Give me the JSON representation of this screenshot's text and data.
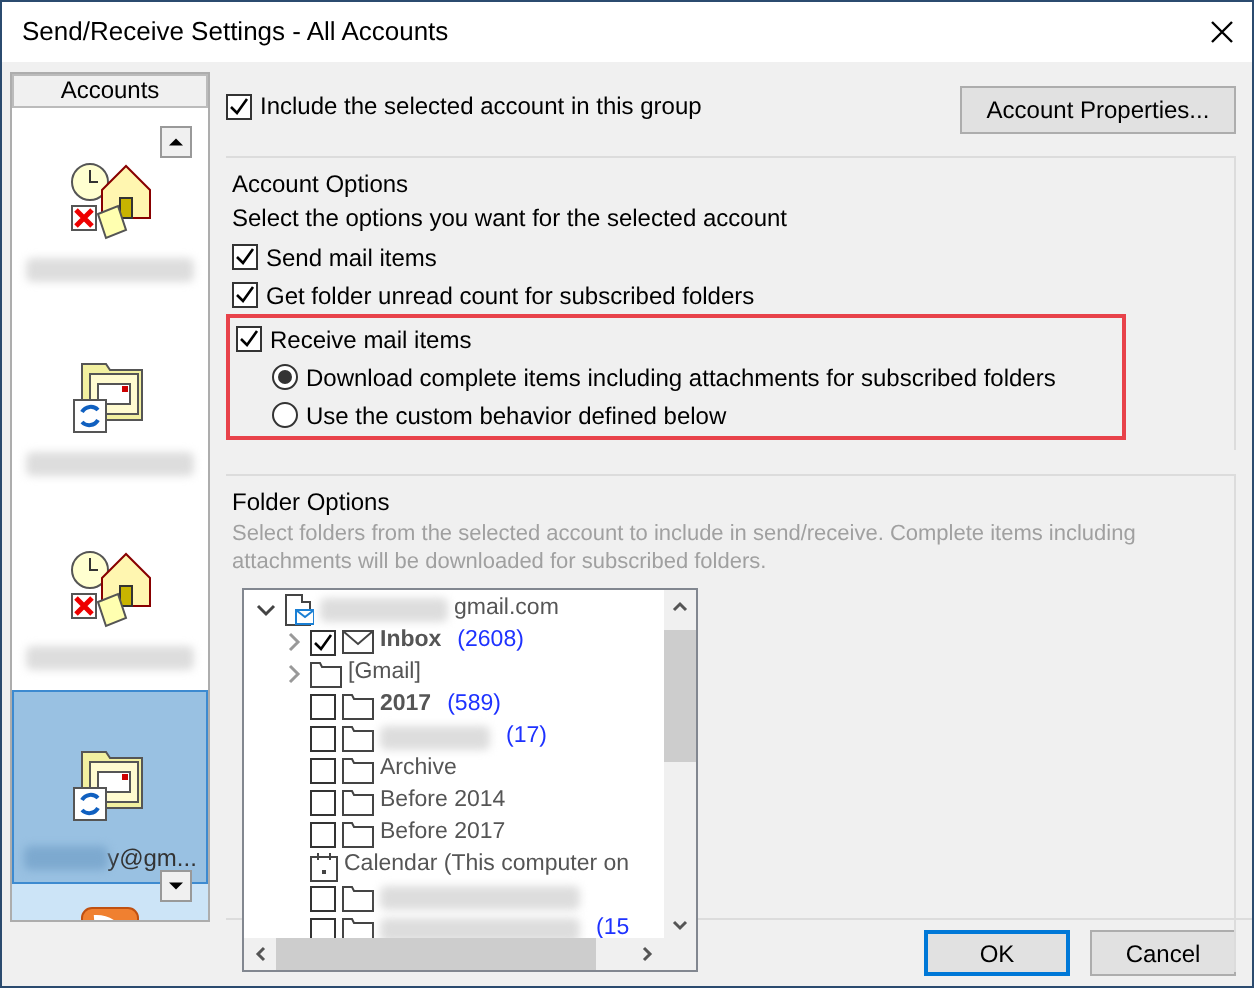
{
  "window": {
    "title": "Send/Receive Settings - All Accounts"
  },
  "accounts": {
    "header": "Accounts",
    "items": [
      {
        "kind": "send-receive",
        "selected": false
      },
      {
        "kind": "mailbox",
        "selected": false
      },
      {
        "kind": "send-receive",
        "selected": false
      },
      {
        "kind": "mailbox",
        "selected": true,
        "label": "y@gm..."
      },
      {
        "kind": "rss",
        "selected": false
      }
    ]
  },
  "include_account": {
    "label": "Include the selected account in this group",
    "checked": true
  },
  "account_properties_button": "Account Properties...",
  "account_options": {
    "title": "Account Options",
    "instruction": "Select the options you want for the selected account",
    "checkboxes": [
      {
        "label": "Send mail items",
        "checked": true
      },
      {
        "label": "Get folder unread count for subscribed folders",
        "checked": true
      },
      {
        "label": "Receive mail items",
        "checked": true
      }
    ],
    "radios": [
      {
        "label": "Download complete items including attachments for subscribed folders",
        "selected": true
      },
      {
        "label": "Use the custom behavior defined below",
        "selected": false
      }
    ]
  },
  "folder_options": {
    "title": "Folder Options",
    "description": "Select folders from the selected account to include in send/receive. Complete items including attachments will be downloaded for subscribed folders.",
    "tree": {
      "label": "gmail.com",
      "expanded": true,
      "children": [
        {
          "kind": "mail-folder",
          "label": "Inbox",
          "count": "(2608)",
          "bold": true,
          "checked": true
        },
        {
          "kind": "group",
          "label": "[Gmail]"
        },
        {
          "kind": "folder",
          "label": "2017",
          "count": "(589)",
          "bold": true,
          "checked": false
        },
        {
          "kind": "folder",
          "count": "(17)",
          "checked": false
        },
        {
          "kind": "folder",
          "label": "Archive",
          "bold": false,
          "checked": false
        },
        {
          "kind": "folder",
          "label": "Before 2014",
          "bold": false,
          "checked": false
        },
        {
          "kind": "folder",
          "label": "Before 2017",
          "bold": false,
          "checked": false
        },
        {
          "kind": "calendar",
          "label": "Calendar (This computer on"
        },
        {
          "kind": "folder",
          "checked": false
        },
        {
          "kind": "folder",
          "count": "(15",
          "checked": false
        }
      ]
    }
  },
  "buttons": [
    {
      "label": "OK",
      "default": true
    },
    {
      "label": "Cancel",
      "default": false
    }
  ]
}
